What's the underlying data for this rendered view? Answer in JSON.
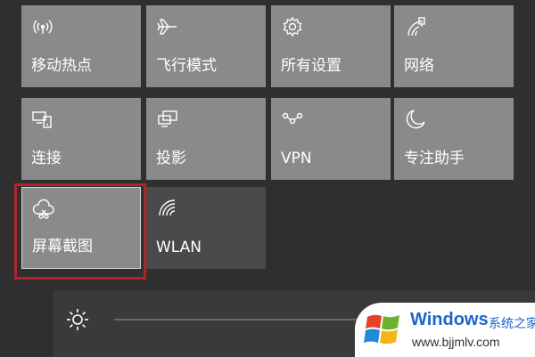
{
  "tiles": [
    {
      "label": "移动热点",
      "icon": "mobile-hotspot-icon"
    },
    {
      "label": "飞行模式",
      "icon": "airplane-icon"
    },
    {
      "label": "所有设置",
      "icon": "gear-icon"
    },
    {
      "label": "网络",
      "icon": "network-icon"
    },
    {
      "label": "连接",
      "icon": "connect-icon"
    },
    {
      "label": "投影",
      "icon": "project-icon"
    },
    {
      "label": "VPN",
      "icon": "vpn-icon"
    },
    {
      "label": "专注助手",
      "icon": "moon-icon"
    },
    {
      "label": "屏幕截图",
      "icon": "screen-snip-icon",
      "selected": true
    },
    {
      "label": "WLAN",
      "icon": "wifi-icon",
      "state": "off"
    }
  ],
  "brightness": {
    "icon": "sun-icon"
  },
  "watermark": {
    "title": "Windows",
    "subtitle": "系统之家",
    "url": "www.bjjmlv.com"
  },
  "colors": {
    "tile_on": "#8a8a8a",
    "tile_off": "#4a4a4a",
    "highlight_border": "#b3232a",
    "watermark_blue": "#1b66c9"
  }
}
